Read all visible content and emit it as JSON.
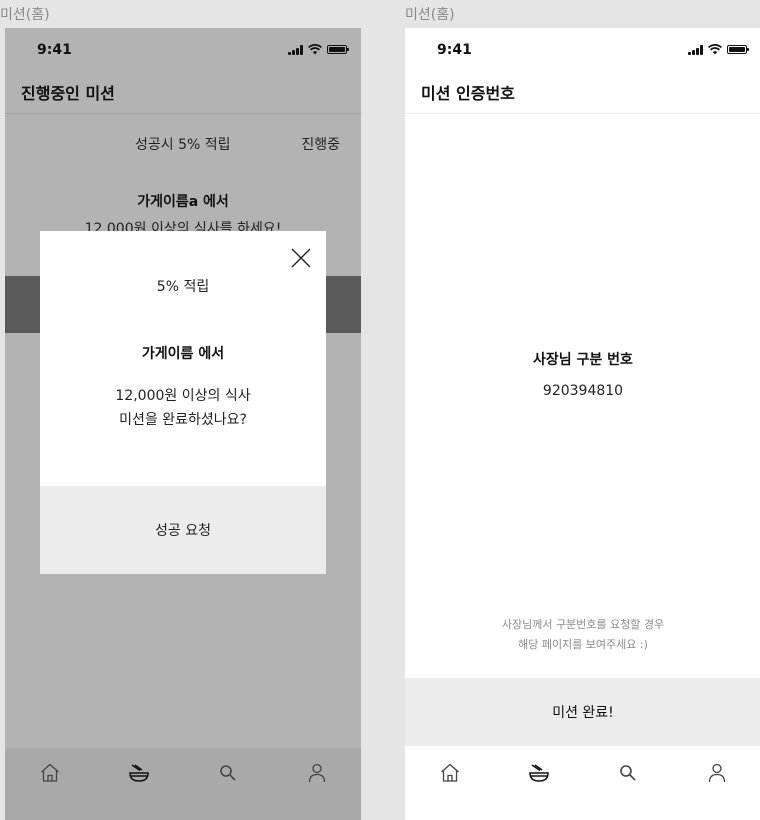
{
  "frames": {
    "left_label": "미션(홈)",
    "right_label": "미션(홈)"
  },
  "status_bar": {
    "time": "9:41",
    "icons": [
      "signal-icon",
      "wifi-icon",
      "battery-icon"
    ]
  },
  "left_screen": {
    "title": "진행중인 미션",
    "reward": "성공시 5% 적립",
    "status": "진행중",
    "store": "가게이름a 에서",
    "mission": "12,000원 이상의 식사를 하세요!",
    "modal": {
      "reward": "5% 적립",
      "store": "가게이름 에서",
      "line1": "12,000원 이상의 식사",
      "line2": "미션을 완료하셨나요?",
      "button": "성공 요청",
      "close_icon": "close-icon"
    }
  },
  "right_screen": {
    "title": "미션 인증번호",
    "owner_label": "사장님 구분 번호",
    "owner_code": "920394810",
    "notice_line1": "사장님께서 구분번호를 요청할 경우",
    "notice_line2": "해당 페이지를 보여주세요 :)",
    "complete_button": "미션 완료!"
  },
  "tab_bar": {
    "icons": [
      "home-icon",
      "bowl-icon",
      "search-icon",
      "person-icon"
    ]
  },
  "colors": {
    "overlay_background": "#b3b3b3",
    "modal_background": "#ffffff",
    "button_background": "#ececec"
  }
}
